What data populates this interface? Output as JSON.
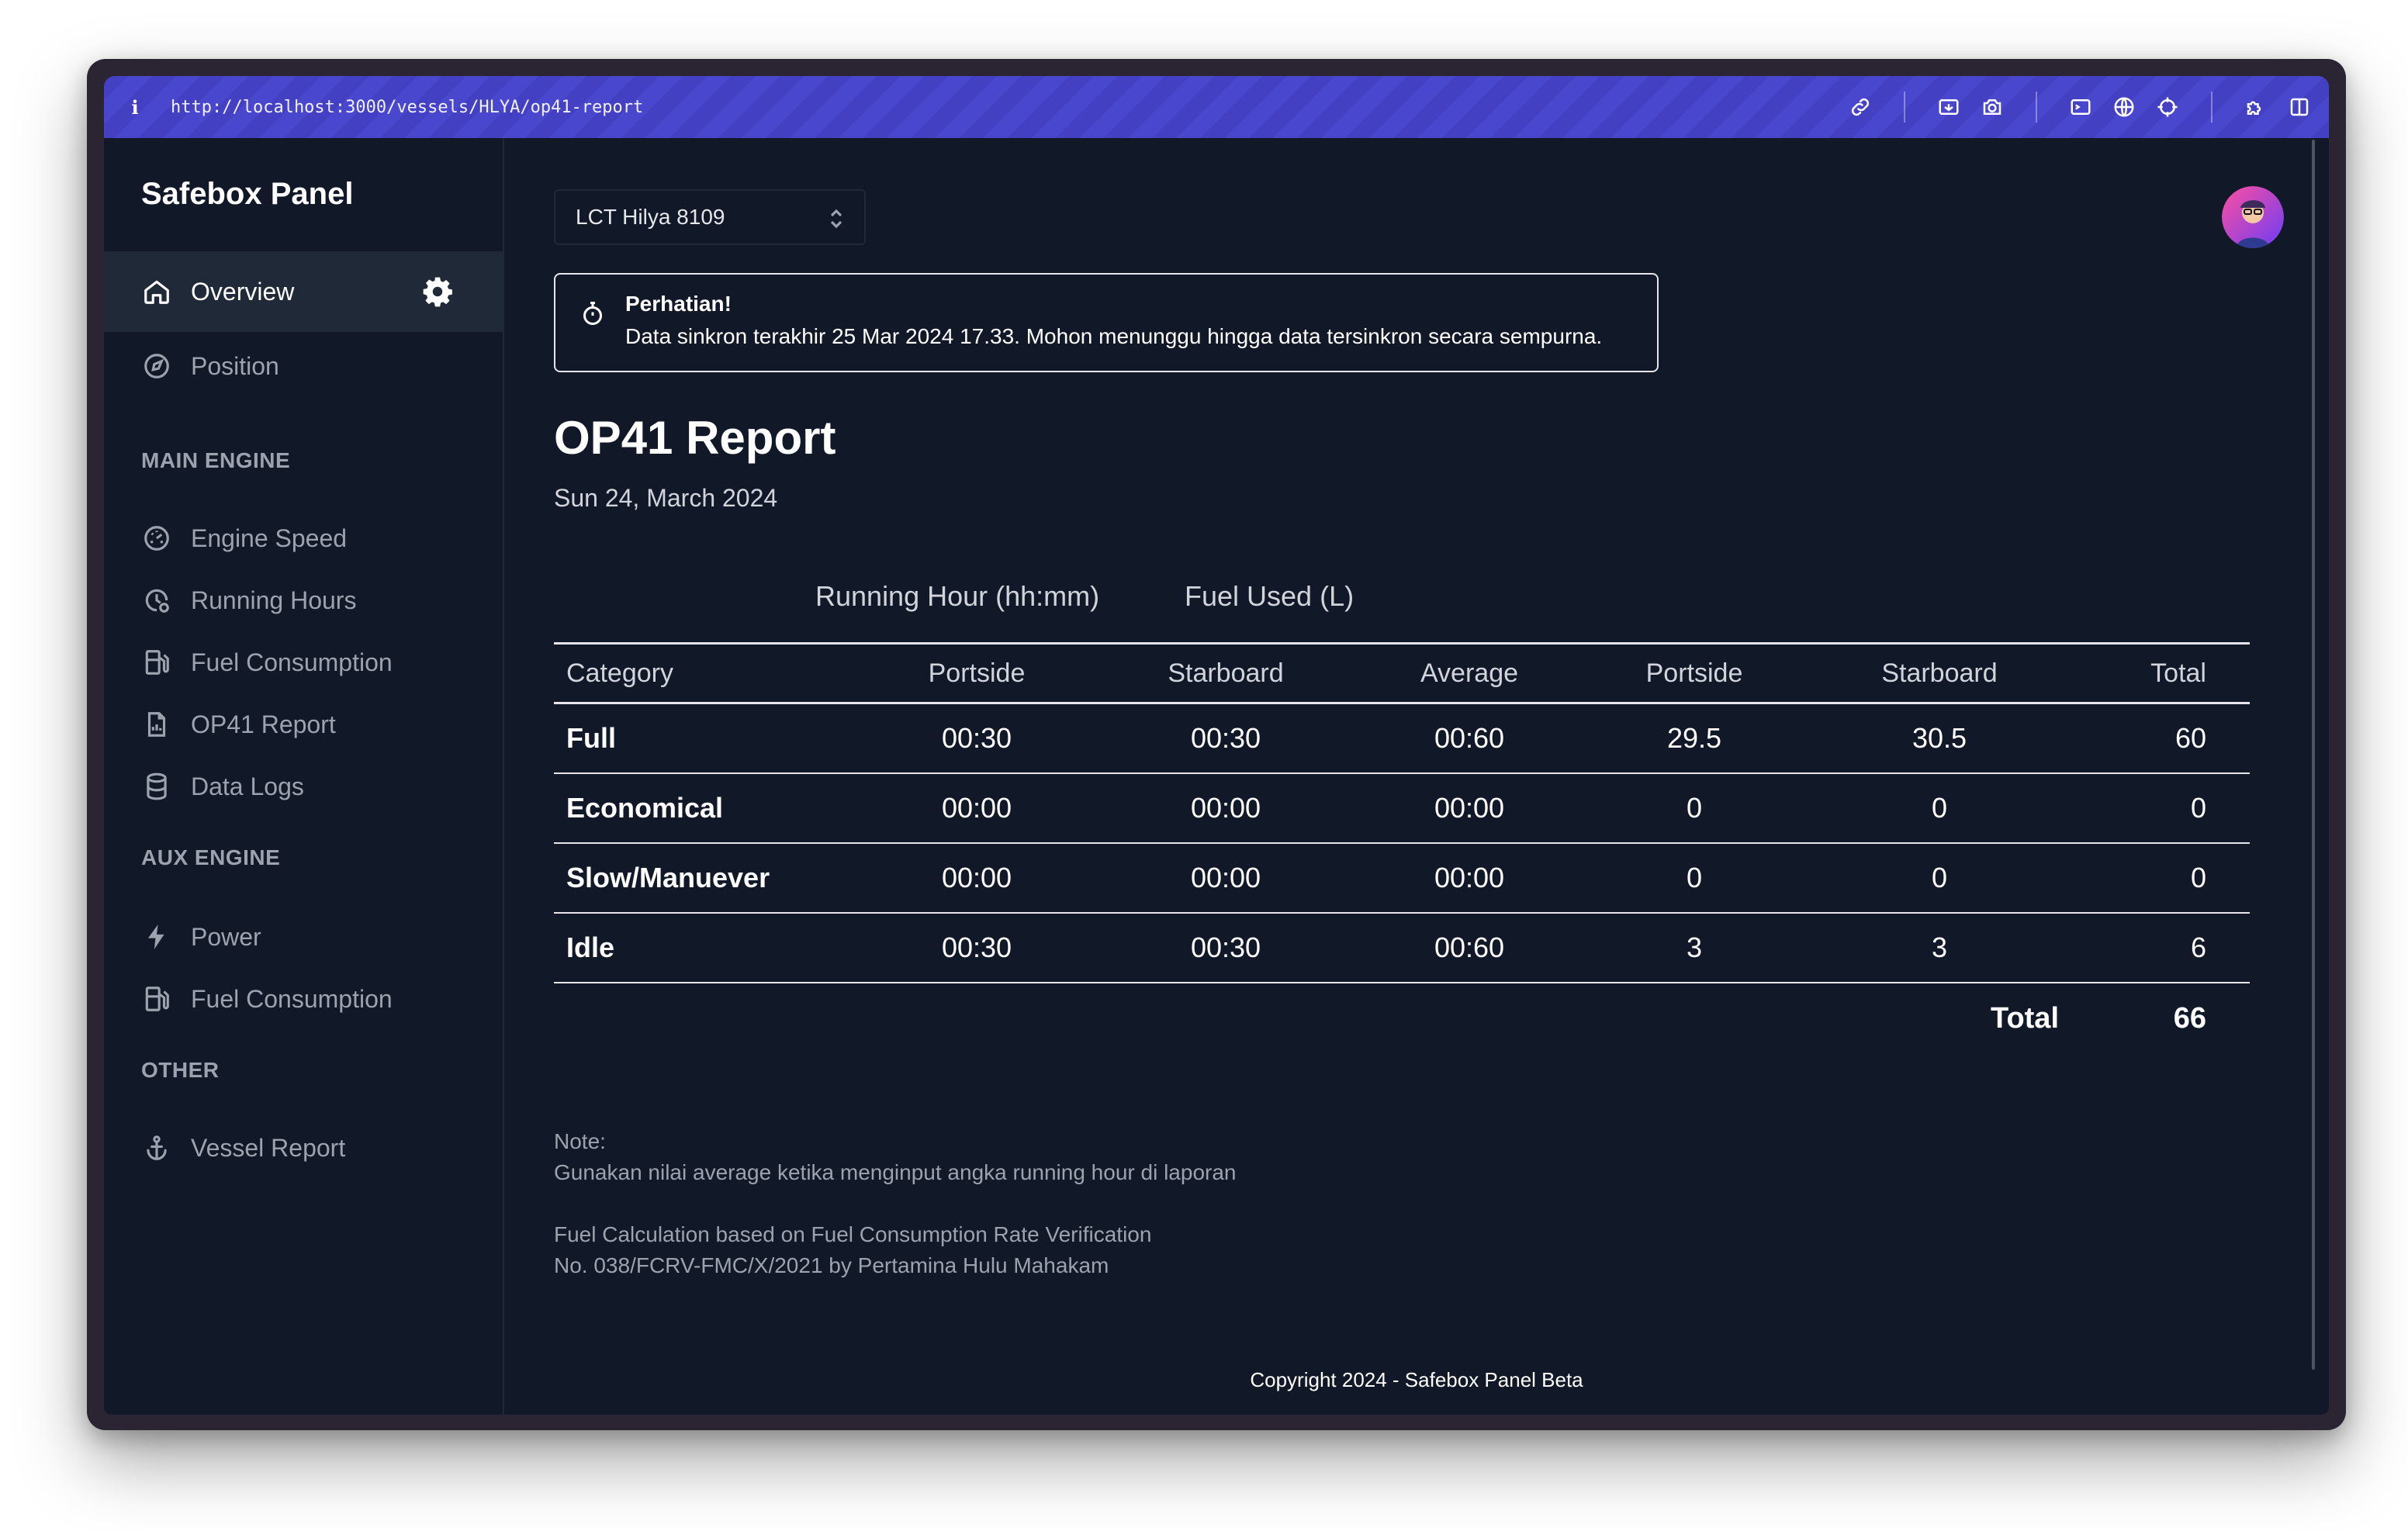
{
  "browser": {
    "url": "http://localhost:3000/vessels/HLYA/op41-report"
  },
  "sidebar": {
    "brand": "Safebox Panel",
    "items": [
      {
        "label": "Overview",
        "icon": "home-icon"
      },
      {
        "label": "Position",
        "icon": "navigation-icon"
      }
    ],
    "sections": [
      {
        "title": "MAIN ENGINE",
        "items": [
          {
            "label": "Engine Speed",
            "icon": "gauge-icon"
          },
          {
            "label": "Running Hours",
            "icon": "clock-icon"
          },
          {
            "label": "Fuel Consumption",
            "icon": "fuel-icon"
          },
          {
            "label": "OP41 Report",
            "icon": "report-icon"
          },
          {
            "label": "Data Logs",
            "icon": "database-icon"
          }
        ]
      },
      {
        "title": "AUX ENGINE",
        "items": [
          {
            "label": "Power",
            "icon": "bolt-icon"
          },
          {
            "label": "Fuel Consumption",
            "icon": "fuel-icon"
          }
        ]
      },
      {
        "title": "OTHER",
        "items": [
          {
            "label": "Vessel Report",
            "icon": "anchor-icon"
          }
        ]
      }
    ]
  },
  "vessel_select": {
    "value": "LCT Hilya 8109"
  },
  "alert": {
    "title": "Perhatian!",
    "message": "Data sinkron terakhir 25 Mar 2024 17.33. Mohon menunggu hingga data tersinkron secara sempurna."
  },
  "report": {
    "title": "OP41 Report",
    "date": "Sun 24, March 2024",
    "group_headers": [
      "Running Hour (hh:mm)",
      "Fuel Used (L)"
    ],
    "columns": [
      "Category",
      "Portside",
      "Starboard",
      "Average",
      "Portside",
      "Starboard",
      "Total"
    ],
    "rows": [
      [
        "Full",
        "00:30",
        "00:30",
        "00:60",
        "29.5",
        "30.5",
        "60"
      ],
      [
        "Economical",
        "00:00",
        "00:00",
        "00:00",
        "0",
        "0",
        "0"
      ],
      [
        "Slow/Manuever",
        "00:00",
        "00:00",
        "00:00",
        "0",
        "0",
        "0"
      ],
      [
        "Idle",
        "00:30",
        "00:30",
        "00:60",
        "3",
        "3",
        "6"
      ]
    ],
    "total_label": "Total",
    "total_value": "66"
  },
  "notes": {
    "note_label": "Note:",
    "note_text": "Gunakan nilai average ketika menginput angka running hour di laporan",
    "calc_line1": "Fuel Calculation based on Fuel Consumption Rate Verification",
    "calc_line2": "No. 038/FCRV-FMC/X/2021 by Pertamina Hulu Mahakam"
  },
  "footer": {
    "text": "Copyright 2024 - Safebox Panel Beta"
  },
  "colors": {
    "background": "#111827",
    "sidebar_active": "#1f2937",
    "titlebar": "#4340c4",
    "text_muted": "#9ca3af"
  }
}
